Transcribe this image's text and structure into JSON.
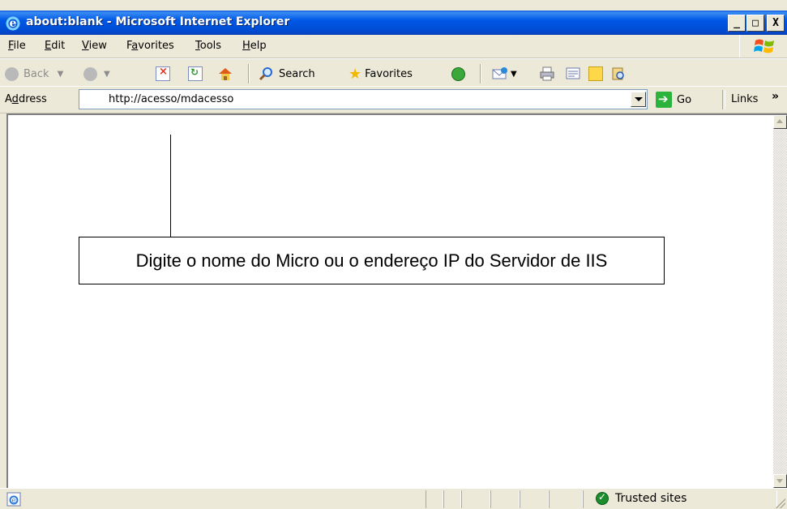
{
  "window": {
    "title": "about:blank - Microsoft Internet Explorer",
    "minimize_glyph": "_",
    "maximize_glyph": "□",
    "close_glyph": "X"
  },
  "menu": {
    "file": {
      "key": "F",
      "rest": "ile"
    },
    "edit": {
      "key": "E",
      "rest": "dit"
    },
    "view": {
      "key": "V",
      "rest": "iew"
    },
    "favorites": {
      "pre": "F",
      "key": "a",
      "rest": "vorites"
    },
    "tools": {
      "key": "T",
      "rest": "ools"
    },
    "help": {
      "key": "H",
      "rest": "elp"
    }
  },
  "toolbar": {
    "back": "Back",
    "search": "Search",
    "favorites": "Favorites"
  },
  "address": {
    "label_pre": "A",
    "label_key": "d",
    "label_rest": "dress",
    "value": "http://acesso/mdacesso",
    "go": "Go",
    "links": "Links",
    "chevron": "»"
  },
  "content": {
    "callout_text": "Digite o nome do Micro ou o endereço IP do Servidor de IIS"
  },
  "status": {
    "zone": "Trusted sites"
  },
  "colors": {
    "titlebar": "#0058e6",
    "chrome": "#ece9d8",
    "go_green": "#2bb33c"
  }
}
